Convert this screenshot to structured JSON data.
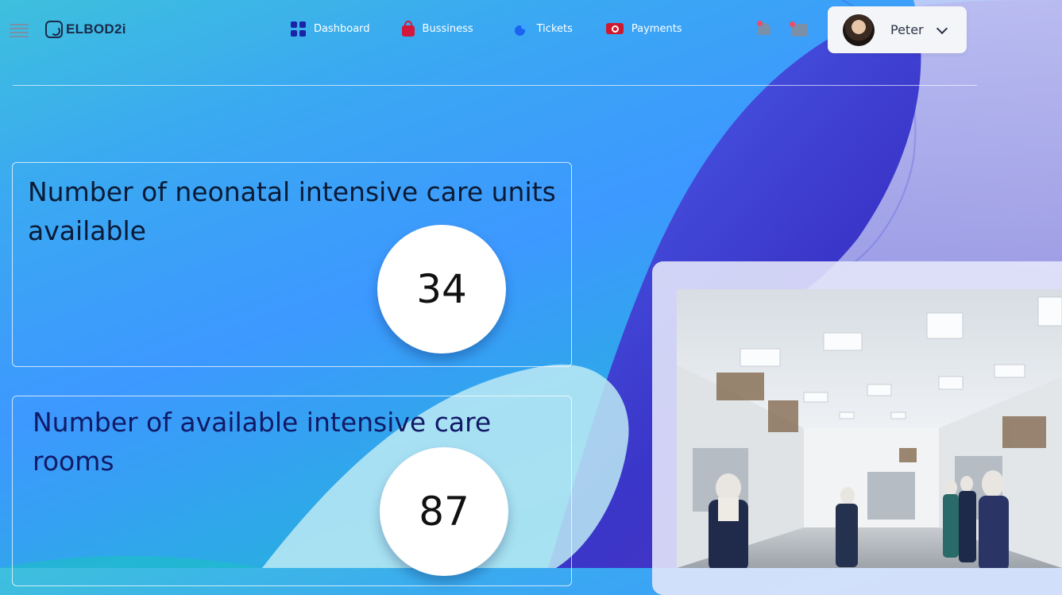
{
  "app": {
    "logo_text": "ELBOD2i"
  },
  "nav": {
    "items": [
      {
        "label": "Dashboard",
        "icon": "dashboard-grid-icon",
        "icon_color": "#1a23a8"
      },
      {
        "label": "Bussiness",
        "icon": "shopping-bag-icon",
        "icon_color": "#d4173a"
      },
      {
        "label": "Tickets",
        "icon": "tickets-dots-icon",
        "icon_color": "#1b63f0"
      },
      {
        "label": "Payments",
        "icon": "payment-card-icon",
        "icon_color": "#d0192f"
      }
    ]
  },
  "header": {
    "notifications_icon": "bell-icon",
    "messages_icon": "mail-icon",
    "badge_color": "#ee4b6a"
  },
  "user": {
    "name": "Peter",
    "menu_icon": "chevron-down-icon"
  },
  "stats": [
    {
      "title": "Number of neonatal intensive care units available",
      "value": "34"
    },
    {
      "title": "Number of available intensive care rooms",
      "value": "87"
    }
  ],
  "media": {
    "image": "hospital-intensive-care-room-photo"
  },
  "colors": {
    "bg_cyan": "#1fbfcf",
    "bg_blue": "#3d98ff",
    "blob_indigo": "#3b3fd6",
    "blob_lavender": "#b9bdf5"
  }
}
